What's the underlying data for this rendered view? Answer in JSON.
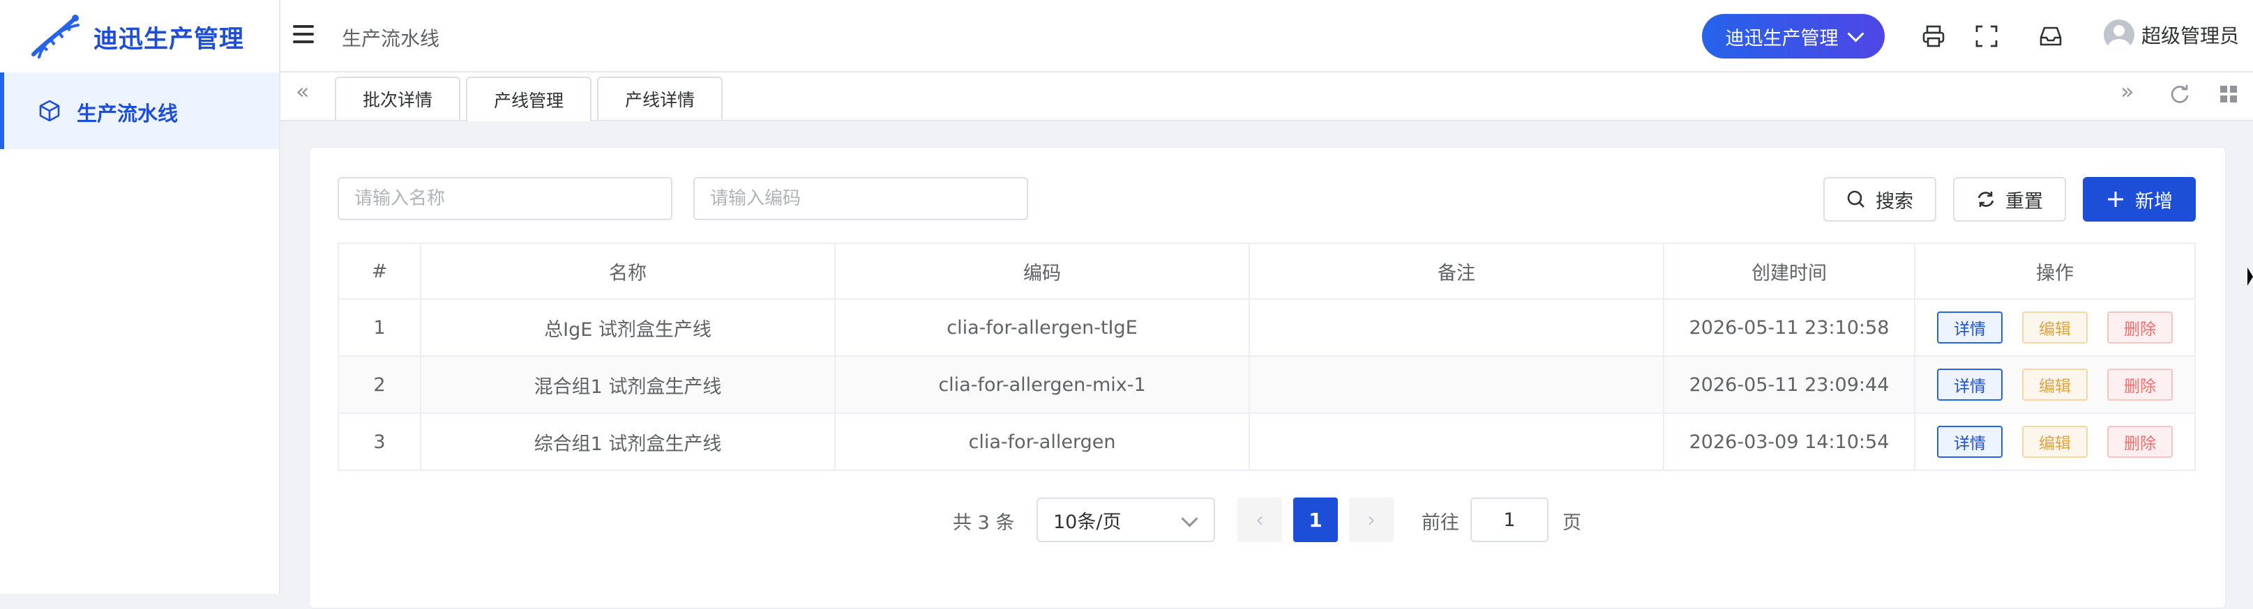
{
  "app": {
    "title": "迪迅生产管理"
  },
  "sidebar": {
    "items": [
      {
        "label": "生产流水线",
        "icon": "cube-icon",
        "active": true
      }
    ]
  },
  "header": {
    "breadcrumb": "生产流水线",
    "system_switcher": "迪迅生产管理",
    "user_name": "超级管理员",
    "icons": [
      "print-icon",
      "fullscreen-icon",
      "inbox-icon",
      "avatar-icon"
    ]
  },
  "tabs": [
    {
      "label": "批次详情",
      "active": false
    },
    {
      "label": "产线管理",
      "active": true
    },
    {
      "label": "产线详情",
      "active": false
    }
  ],
  "filters": {
    "name_placeholder": "请输入名称",
    "code_placeholder": "请输入编码",
    "search_label": "搜索",
    "reset_label": "重置",
    "add_label": "新增"
  },
  "table": {
    "columns": [
      "#",
      "名称",
      "编码",
      "备注",
      "创建时间",
      "操作"
    ],
    "rows": [
      {
        "idx": "1",
        "name": "总IgE 试剂盒生产线",
        "code": "clia-for-allergen-tIgE",
        "remark": "",
        "created": "2026-05-11 23:10:58"
      },
      {
        "idx": "2",
        "name": "混合组1 试剂盒生产线",
        "code": "clia-for-allergen-mix-1",
        "remark": "",
        "created": "2026-05-11 23:09:44"
      },
      {
        "idx": "3",
        "name": "综合组1 试剂盒生产线",
        "code": "clia-for-allergen",
        "remark": "",
        "created": "2026-03-09 14:10:54"
      }
    ],
    "actions": {
      "detail": "详情",
      "edit": "编辑",
      "delete": "删除"
    }
  },
  "pagination": {
    "total_text": "共 3 条",
    "page_size": "10条/页",
    "current_page": "1",
    "goto_label": "前往",
    "goto_value": "1",
    "page_suffix": "页"
  },
  "colors": {
    "primary": "#1d4ed8",
    "edit": "#e6a23c",
    "delete": "#f56c6c"
  }
}
